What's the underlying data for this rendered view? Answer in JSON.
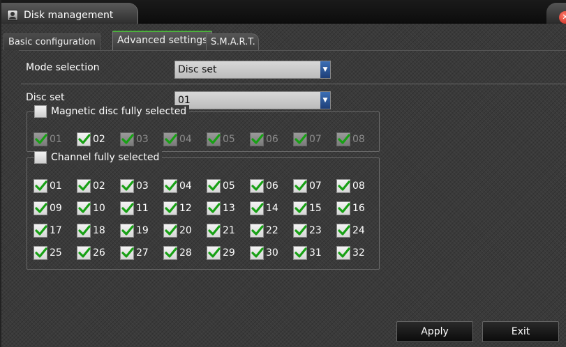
{
  "window": {
    "title": "Disk management"
  },
  "tabs": [
    {
      "label": "Basic configuration",
      "active": false
    },
    {
      "label": "Advanced settings",
      "active": true
    },
    {
      "label": "S.M.A.R.T.",
      "active": false
    }
  ],
  "mode_selection": {
    "label": "Mode selection",
    "value": "Disc set"
  },
  "disc_set": {
    "label": "Disc set",
    "value": "01"
  },
  "disc_group": {
    "title": "Magnetic disc fully selected",
    "checked": false,
    "items": [
      {
        "label": "01",
        "checked": true,
        "disabled": true
      },
      {
        "label": "02",
        "checked": true,
        "disabled": false
      },
      {
        "label": "03",
        "checked": true,
        "disabled": true
      },
      {
        "label": "04",
        "checked": true,
        "disabled": true
      },
      {
        "label": "05",
        "checked": true,
        "disabled": true
      },
      {
        "label": "06",
        "checked": true,
        "disabled": true
      },
      {
        "label": "07",
        "checked": true,
        "disabled": true
      },
      {
        "label": "08",
        "checked": true,
        "disabled": true
      }
    ]
  },
  "channel_group": {
    "title": "Channel fully selected",
    "checked": false,
    "items": [
      {
        "label": "01",
        "checked": true
      },
      {
        "label": "02",
        "checked": true
      },
      {
        "label": "03",
        "checked": true
      },
      {
        "label": "04",
        "checked": true
      },
      {
        "label": "05",
        "checked": true
      },
      {
        "label": "06",
        "checked": true
      },
      {
        "label": "07",
        "checked": true
      },
      {
        "label": "08",
        "checked": true
      },
      {
        "label": "09",
        "checked": true
      },
      {
        "label": "10",
        "checked": true
      },
      {
        "label": "11",
        "checked": true
      },
      {
        "label": "12",
        "checked": true
      },
      {
        "label": "13",
        "checked": true
      },
      {
        "label": "14",
        "checked": true
      },
      {
        "label": "15",
        "checked": true
      },
      {
        "label": "16",
        "checked": true
      },
      {
        "label": "17",
        "checked": true
      },
      {
        "label": "18",
        "checked": true
      },
      {
        "label": "19",
        "checked": true
      },
      {
        "label": "20",
        "checked": true
      },
      {
        "label": "21",
        "checked": true
      },
      {
        "label": "22",
        "checked": true
      },
      {
        "label": "23",
        "checked": true
      },
      {
        "label": "24",
        "checked": true
      },
      {
        "label": "25",
        "checked": true
      },
      {
        "label": "26",
        "checked": true
      },
      {
        "label": "27",
        "checked": true
      },
      {
        "label": "28",
        "checked": true
      },
      {
        "label": "29",
        "checked": true
      },
      {
        "label": "30",
        "checked": true
      },
      {
        "label": "31",
        "checked": true
      },
      {
        "label": "32",
        "checked": true
      }
    ]
  },
  "buttons": {
    "apply": "Apply",
    "exit": "Exit"
  },
  "colors": {
    "check": "#17a014",
    "active_tab_accent": "#4caf3c",
    "select_arrow": "#2a56a0",
    "close": "#d9322a"
  },
  "icons": {
    "title": "user-icon",
    "close": "close-icon",
    "dropdown": "chevron-down-icon",
    "check": "check-icon"
  }
}
